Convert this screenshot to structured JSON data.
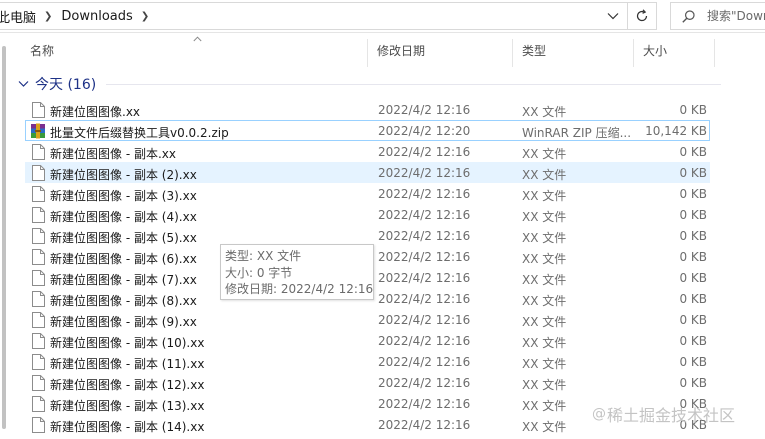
{
  "addressbar": {
    "crumbs": [
      "此电脑",
      "Downloads"
    ],
    "search_placeholder": "搜索\"Downloads\""
  },
  "columns": {
    "name": "名称",
    "date": "修改日期",
    "type": "类型",
    "size": "大小"
  },
  "group": {
    "label": "今天 (16)"
  },
  "files": [
    {
      "name": "新建位图图像.xx",
      "date": "2022/4/2 12:16",
      "type": "XX 文件",
      "size": "0 KB",
      "icon": "file-icon"
    },
    {
      "name": "批量文件后缀替换工具v0.0.2.zip",
      "date": "2022/4/2 12:20",
      "type": "WinRAR ZIP 压缩...",
      "size": "10,142 KB",
      "icon": "winrar-icon"
    },
    {
      "name": "新建位图图像 - 副本.xx",
      "date": "2022/4/2 12:16",
      "type": "XX 文件",
      "size": "0 KB",
      "icon": "file-icon"
    },
    {
      "name": "新建位图图像 - 副本 (2).xx",
      "date": "2022/4/2 12:16",
      "type": "XX 文件",
      "size": "0 KB",
      "icon": "file-icon"
    },
    {
      "name": "新建位图图像 - 副本 (3).xx",
      "date": "2022/4/2 12:16",
      "type": "XX 文件",
      "size": "0 KB",
      "icon": "file-icon"
    },
    {
      "name": "新建位图图像 - 副本 (4).xx",
      "date": "2022/4/2 12:16",
      "type": "XX 文件",
      "size": "0 KB",
      "icon": "file-icon"
    },
    {
      "name": "新建位图图像 - 副本 (5).xx",
      "date": "2022/4/2 12:16",
      "type": "XX 文件",
      "size": "0 KB",
      "icon": "file-icon"
    },
    {
      "name": "新建位图图像 - 副本 (6).xx",
      "date": "2022/4/2 12:16",
      "type": "XX 文件",
      "size": "0 KB",
      "icon": "file-icon"
    },
    {
      "name": "新建位图图像 - 副本 (7).xx",
      "date": "2022/4/2 12:16",
      "type": "XX 文件",
      "size": "0 KB",
      "icon": "file-icon"
    },
    {
      "name": "新建位图图像 - 副本 (8).xx",
      "date": "2022/4/2 12:16",
      "type": "XX 文件",
      "size": "0 KB",
      "icon": "file-icon"
    },
    {
      "name": "新建位图图像 - 副本 (9).xx",
      "date": "2022/4/2 12:16",
      "type": "XX 文件",
      "size": "0 KB",
      "icon": "file-icon"
    },
    {
      "name": "新建位图图像 - 副本 (10).xx",
      "date": "2022/4/2 12:16",
      "type": "XX 文件",
      "size": "0 KB",
      "icon": "file-icon"
    },
    {
      "name": "新建位图图像 - 副本 (11).xx",
      "date": "2022/4/2 12:16",
      "type": "XX 文件",
      "size": "0 KB",
      "icon": "file-icon"
    },
    {
      "name": "新建位图图像 - 副本 (12).xx",
      "date": "2022/4/2 12:16",
      "type": "XX 文件",
      "size": "0 KB",
      "icon": "file-icon"
    },
    {
      "name": "新建位图图像 - 副本 (13).xx",
      "date": "2022/4/2 12:16",
      "type": "XX 文件",
      "size": "0 KB",
      "icon": "file-icon"
    },
    {
      "name": "新建位图图像 - 副本 (14).xx",
      "date": "2022/4/2 12:16",
      "type": "XX 文件",
      "size": "0 KB",
      "icon": "file-icon"
    }
  ],
  "tooltip": {
    "type_line": "类型: XX 文件",
    "size_line": "大小: 0 字节",
    "date_line": "修改日期: 2022/4/2 12:16"
  },
  "watermark": {
    "text": "稀土掘金技术社区"
  },
  "colors": {
    "group_header": "#1e3287",
    "hover_row": "#e5f3ff",
    "focus_border": "#99d1ff"
  }
}
